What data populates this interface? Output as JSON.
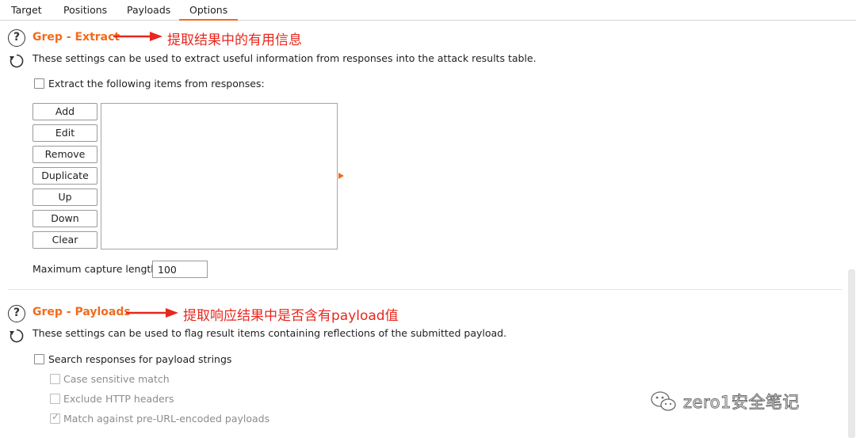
{
  "tabs": [
    {
      "label": "Target",
      "active": false
    },
    {
      "label": "Positions",
      "active": false
    },
    {
      "label": "Payloads",
      "active": false
    },
    {
      "label": "Options",
      "active": true
    }
  ],
  "accent_color": "#f26b1d",
  "annotation_color": "#e8271d",
  "grep_extract": {
    "title": "Grep - Extract",
    "annotation": "提取结果中的有用信息",
    "description": "These settings can be used to extract useful information from responses into the attack results table.",
    "checkbox_label": "Extract the following items from responses:",
    "checked": false,
    "buttons": [
      "Add",
      "Edit",
      "Remove",
      "Duplicate",
      "Up",
      "Down",
      "Clear"
    ],
    "max_capture_label": "Maximum capture length:",
    "max_capture_value": "100"
  },
  "grep_payloads": {
    "title": "Grep - Payloads",
    "annotation": "提取响应结果中是否含有payload值",
    "description": "These settings can be used to flag result items containing reflections of the submitted payload.",
    "search_label": "Search responses for payload strings",
    "search_checked": false,
    "options": [
      {
        "label": "Case sensitive match",
        "checked": false
      },
      {
        "label": "Exclude HTTP headers",
        "checked": false
      },
      {
        "label": "Match against pre-URL-encoded payloads",
        "checked": true
      }
    ]
  },
  "watermark": {
    "text": "zero1安全笔记",
    "icon": "wechat-icon"
  }
}
